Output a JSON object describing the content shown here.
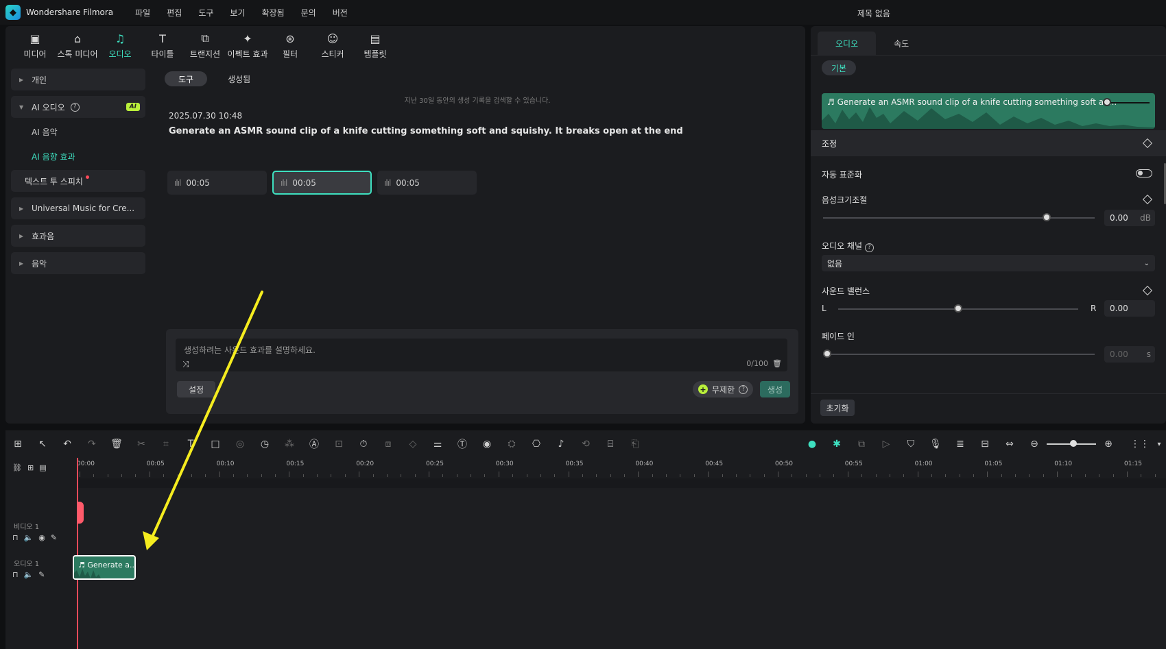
{
  "app": {
    "name": "Wondershare Filmora",
    "doc_title": "제목 없음",
    "menu": [
      "파일",
      "편집",
      "도구",
      "보기",
      "확장됨",
      "문의",
      "버전"
    ]
  },
  "toolbar": {
    "items": [
      {
        "label": "미디어",
        "icon": "media-icon"
      },
      {
        "label": "스톡 미디어",
        "icon": "stock-media-icon"
      },
      {
        "label": "오디오",
        "icon": "music-note-icon"
      },
      {
        "label": "타이틀",
        "icon": "title-T-icon"
      },
      {
        "label": "트랜지션",
        "icon": "transition-icon"
      },
      {
        "label": "이펙트 효과",
        "icon": "effects-icon"
      },
      {
        "label": "필터",
        "icon": "filter-icon"
      },
      {
        "label": "스티커",
        "icon": "sticker-icon"
      },
      {
        "label": "템플릿",
        "icon": "template-icon"
      }
    ],
    "active_index": 2
  },
  "leftnav": {
    "personal": "개인",
    "ai_audio": "AI 오디오",
    "ai_badge": "AI",
    "ai_music": "AI 음악",
    "ai_sfx": "AI 음향 효과",
    "tts": "텍스트 투 스피치",
    "universal": "Universal Music for Cre...",
    "sfx": "효과음",
    "music": "음악"
  },
  "content": {
    "tabs": [
      "도구",
      "생성됨"
    ],
    "hint": "지난 30일 동안의 생성 기록을 검색할 수 있습니다.",
    "date": "2025.07.30 10:48",
    "prompt": "Generate an ASMR sound clip of a knife cutting something soft and squishy. It breaks open at the end",
    "clips": [
      "00:05",
      "00:05",
      "00:05"
    ],
    "active_clip": 1,
    "placeholder": "생성하려는 사운드 효과를 설명하세요.",
    "counter": "0/100",
    "settings": "설정",
    "unlimited": "무제한",
    "generate": "생성"
  },
  "inspector": {
    "tabs": [
      "오디오",
      "속도"
    ],
    "basic": "기본",
    "clip_title": "Generate an ASMR sound clip of a knife cutting something soft an...",
    "adjust": "조정",
    "auto_normalize": "자동 표준화",
    "volume": "음성크기조절",
    "volume_value": "0.00",
    "volume_unit": "dB",
    "channel": "오디오 채널",
    "channel_value": "없음",
    "balance": "사운드 밸런스",
    "balance_L": "L",
    "balance_R": "R",
    "balance_value": "0.00",
    "fade_in": "페이드 인",
    "fade_value": "0.00",
    "fade_unit": "s",
    "reset": "초기화"
  },
  "timeline": {
    "ticks": [
      "00:00",
      "00:05",
      "00:10",
      "00:15",
      "00:20",
      "00:25",
      "00:30",
      "00:35",
      "00:40",
      "00:45",
      "00:50",
      "00:55",
      "01:00",
      "01:05",
      "01:10",
      "01:15"
    ],
    "video_track": "비디오 1",
    "audio_track": "오디오 1",
    "audio_clip": "Generate a..."
  },
  "colors": {
    "accent": "#3ee0c0",
    "clip_green": "#2c7a60",
    "playhead": "#ff4a5a",
    "annotation_arrow": "#f5ec1f"
  }
}
